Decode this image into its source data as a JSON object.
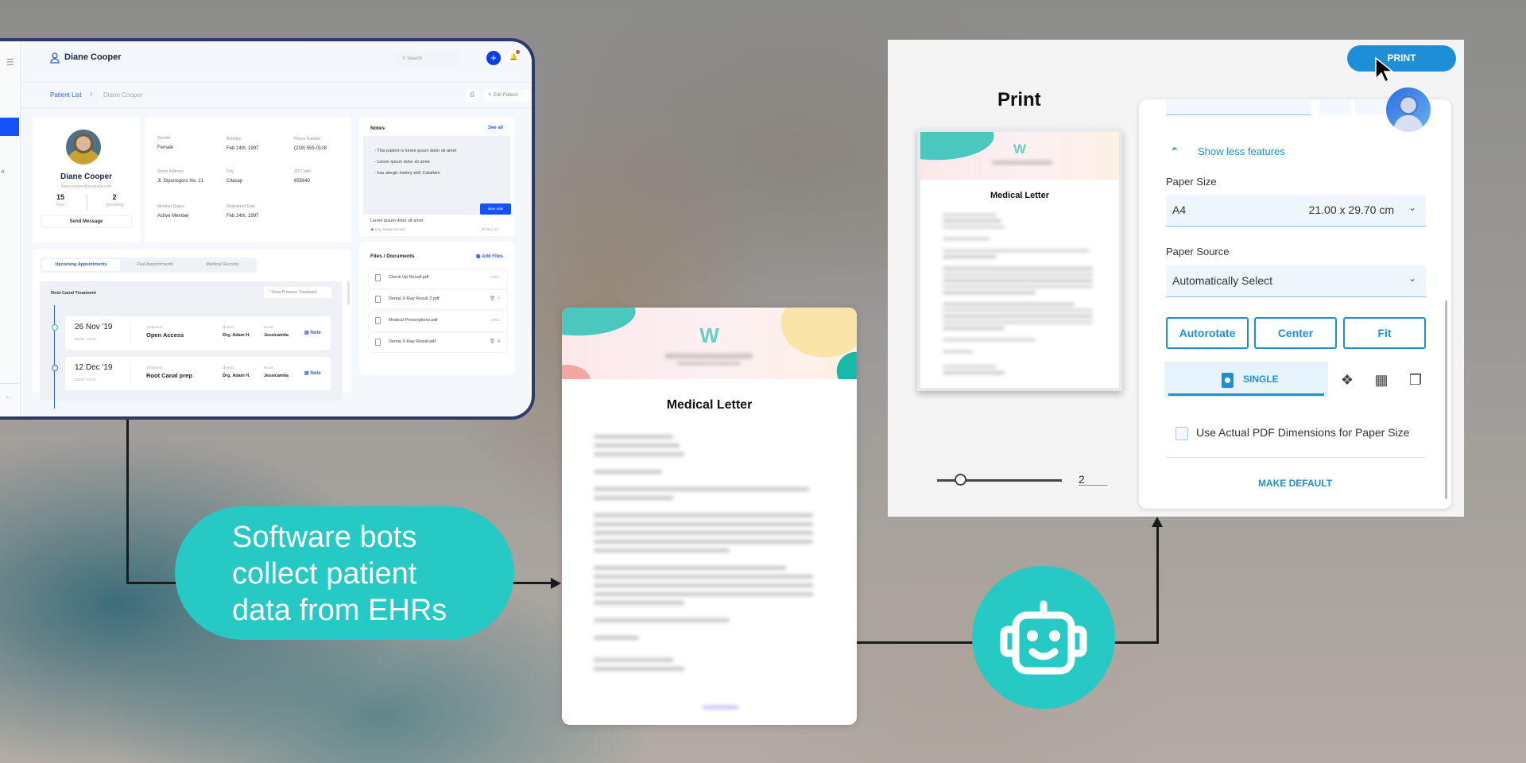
{
  "ehr": {
    "app_title": "Diane Cooper",
    "search_placeholder": "Search",
    "add_icon": "plus-icon",
    "notifications_icon": "bell-icon",
    "breadcrumb": {
      "root": "Patient List",
      "current": "Diane Cooper"
    },
    "edit_patient_label": "Edit Patient",
    "profile": {
      "name": "Diane Cooper",
      "email": "diane.cooper@example.com",
      "stats": [
        {
          "value": "15",
          "label": "Post"
        },
        {
          "value": "2",
          "label": "Upcoming"
        }
      ],
      "send_message_label": "Send Message"
    },
    "info": [
      {
        "label": "Gender",
        "value": "Female"
      },
      {
        "label": "Birthday",
        "value": "Feb 24th, 1997"
      },
      {
        "label": "Phone Number",
        "value": "(239) 555-0108"
      },
      {
        "label": "Street Address",
        "value": "Jl. Diponegoro No. 21"
      },
      {
        "label": "City",
        "value": "Cilacap"
      },
      {
        "label": "ZIP Code",
        "value": "655849"
      },
      {
        "label": "Member Status",
        "value": "Active Member"
      },
      {
        "label": "Registered Date",
        "value": "Feb 24th, 1997"
      }
    ],
    "tabs": [
      "Upcoming Appointments",
      "Past Appointments",
      "Medical Records"
    ],
    "treatment_group": "Root Canal Treatment",
    "show_previous_label": "Show Previous Treatment",
    "appointments": [
      {
        "date": "26 Nov '19",
        "time": "09.00 - 10.00",
        "treatment_label": "Treatment",
        "treatment": "Open Access",
        "dentist_label": "Dentist",
        "dentist": "Drg. Adam H.",
        "nurse_label": "Nurse",
        "nurse": "Jessicamila",
        "note_label": "Note"
      },
      {
        "date": "12 Dec '19",
        "time": "09.00 - 10.00",
        "treatment_label": "Treatment",
        "treatment": "Root Canal prep",
        "dentist_label": "Dentist",
        "dentist": "Drg. Adam H.",
        "nurse_label": "Nurse",
        "nurse": "Jessicamila",
        "note_label": "Note"
      }
    ],
    "notes": {
      "title": "Notes",
      "see_all": "See all",
      "lines": [
        "- This patient is lorem ipsum dolor sit amet",
        "- Lorem ipsum dolor sit amet",
        "- has alergic history with Cataflam"
      ],
      "save_label": "save note",
      "recent": {
        "text": "Lorem ipsum dolor sit amet",
        "author": "Drg. Mega Nanade",
        "date": "20 Nov '19"
      }
    },
    "files": {
      "title": "Files / Documents",
      "add_label": "Add Files",
      "items": [
        {
          "name": "Check Up Result.pdf",
          "size": "123kb"
        },
        {
          "name": "Dental X-Ray Result 2.pdf",
          "size": ""
        },
        {
          "name": "Medical Prescriptions.pdf",
          "size": "87kb"
        },
        {
          "name": "Dental X-Ray Result.pdf",
          "size": ""
        }
      ]
    }
  },
  "callout": {
    "lines": [
      "Software bots",
      "collect patient",
      "data from EHRs"
    ],
    "color": "#27c9c4"
  },
  "letter": {
    "title": "Medical Letter",
    "logo": "W"
  },
  "print_dialog": {
    "title": "Print",
    "print_button": "PRINT",
    "preview_title": "Medical Letter",
    "copies_value": "2",
    "show_less_label": "Show less features",
    "paper_size": {
      "label": "Paper Size",
      "value": "A4",
      "dimensions": "21.00 x 29.70 cm"
    },
    "paper_source": {
      "label": "Paper Source",
      "value": "Automatically Select"
    },
    "orientation_buttons": [
      "Autorotate",
      "Center",
      "Fit"
    ],
    "layout_selected": "SINGLE",
    "layout_icons": [
      "booklet-icon",
      "grid-icon",
      "duplex-icon"
    ],
    "use_pdf_dimensions_label": "Use Actual PDF Dimensions for Paper Size",
    "use_pdf_dimensions_checked": false,
    "make_default_label": "MAKE DEFAULT",
    "accent": "#1c8fd8"
  }
}
